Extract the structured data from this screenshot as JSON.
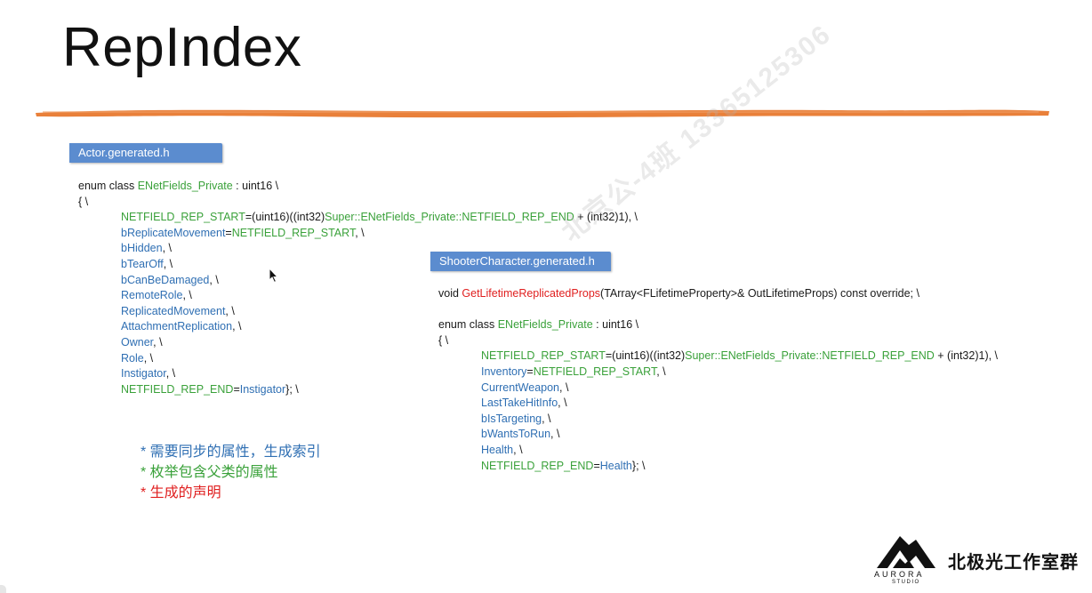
{
  "title": "RepIndex",
  "left_file": {
    "tag": "Actor.generated.h",
    "lines": [
      {
        "indent": 0,
        "parts": [
          {
            "t": "enum class ",
            "c": "k"
          },
          {
            "t": "ENetFields_Private",
            "c": "g"
          },
          {
            "t": " : uint16 \\",
            "c": "k"
          }
        ]
      },
      {
        "indent": 0,
        "parts": [
          {
            "t": "{ \\",
            "c": "k"
          }
        ]
      },
      {
        "indent": 1,
        "parts": [
          {
            "t": "NETFIELD_REP_START",
            "c": "g"
          },
          {
            "t": "=(uint16)((int32)",
            "c": "k"
          },
          {
            "t": "Super::ENetFields_Private::NETFIELD_REP_END",
            "c": "g"
          },
          {
            "t": " + (int32)1), \\",
            "c": "k"
          }
        ]
      },
      {
        "indent": 1,
        "parts": [
          {
            "t": "bReplicateMovement",
            "c": "b"
          },
          {
            "t": "=",
            "c": "k"
          },
          {
            "t": "NETFIELD_REP_START",
            "c": "g"
          },
          {
            "t": ", \\",
            "c": "k"
          }
        ]
      },
      {
        "indent": 1,
        "parts": [
          {
            "t": "bHidden",
            "c": "b"
          },
          {
            "t": ", \\",
            "c": "k"
          }
        ]
      },
      {
        "indent": 1,
        "parts": [
          {
            "t": "bTearOff",
            "c": "b"
          },
          {
            "t": ", \\",
            "c": "k"
          }
        ]
      },
      {
        "indent": 1,
        "parts": [
          {
            "t": "bCanBeDamaged",
            "c": "b"
          },
          {
            "t": ", \\",
            "c": "k"
          }
        ]
      },
      {
        "indent": 1,
        "parts": [
          {
            "t": "RemoteRole",
            "c": "b"
          },
          {
            "t": ", \\",
            "c": "k"
          }
        ]
      },
      {
        "indent": 1,
        "parts": [
          {
            "t": "ReplicatedMovement",
            "c": "b"
          },
          {
            "t": ", \\",
            "c": "k"
          }
        ]
      },
      {
        "indent": 1,
        "parts": [
          {
            "t": "AttachmentReplication",
            "c": "b"
          },
          {
            "t": ", \\",
            "c": "k"
          }
        ]
      },
      {
        "indent": 1,
        "parts": [
          {
            "t": "Owner",
            "c": "b"
          },
          {
            "t": ", \\",
            "c": "k"
          }
        ]
      },
      {
        "indent": 1,
        "parts": [
          {
            "t": "Role",
            "c": "b"
          },
          {
            "t": ", \\",
            "c": "k"
          }
        ]
      },
      {
        "indent": 1,
        "parts": [
          {
            "t": "Instigator",
            "c": "b"
          },
          {
            "t": ", \\",
            "c": "k"
          }
        ]
      },
      {
        "indent": 1,
        "parts": [
          {
            "t": "NETFIELD_REP_END",
            "c": "g"
          },
          {
            "t": "=",
            "c": "k"
          },
          {
            "t": "Instigator",
            "c": "b"
          },
          {
            "t": "}; \\",
            "c": "k"
          }
        ]
      }
    ]
  },
  "right_file": {
    "tag": "ShooterCharacter.generated.h",
    "lines": [
      {
        "indent": 0,
        "parts": [
          {
            "t": "void ",
            "c": "k"
          },
          {
            "t": "GetLifetimeReplicatedProps",
            "c": "r"
          },
          {
            "t": "(TArray<FLifetimeProperty>& OutLifetimeProps) const override; \\",
            "c": "k"
          }
        ]
      },
      {
        "indent": 0,
        "parts": []
      },
      {
        "indent": 0,
        "parts": [
          {
            "t": "enum class ",
            "c": "k"
          },
          {
            "t": "ENetFields_Private",
            "c": "g"
          },
          {
            "t": " : uint16 \\",
            "c": "k"
          }
        ]
      },
      {
        "indent": 0,
        "parts": [
          {
            "t": "{ \\",
            "c": "k"
          }
        ]
      },
      {
        "indent": 1,
        "parts": [
          {
            "t": "NETFIELD_REP_START",
            "c": "g"
          },
          {
            "t": "=(uint16)((int32)",
            "c": "k"
          },
          {
            "t": "Super::ENetFields_Private::NETFIELD_REP_END",
            "c": "g"
          },
          {
            "t": " + (int32)1), \\",
            "c": "k"
          }
        ]
      },
      {
        "indent": 1,
        "parts": [
          {
            "t": "Inventory",
            "c": "b"
          },
          {
            "t": "=",
            "c": "k"
          },
          {
            "t": "NETFIELD_REP_START",
            "c": "g"
          },
          {
            "t": ", \\",
            "c": "k"
          }
        ]
      },
      {
        "indent": 1,
        "parts": [
          {
            "t": "CurrentWeapon",
            "c": "b"
          },
          {
            "t": ", \\",
            "c": "k"
          }
        ]
      },
      {
        "indent": 1,
        "parts": [
          {
            "t": "LastTakeHitInfo",
            "c": "b"
          },
          {
            "t": ", \\",
            "c": "k"
          }
        ]
      },
      {
        "indent": 1,
        "parts": [
          {
            "t": "bIsTargeting",
            "c": "b"
          },
          {
            "t": ", \\",
            "c": "k"
          }
        ]
      },
      {
        "indent": 1,
        "parts": [
          {
            "t": "bWantsToRun",
            "c": "b"
          },
          {
            "t": ", \\",
            "c": "k"
          }
        ]
      },
      {
        "indent": 1,
        "parts": [
          {
            "t": "Health",
            "c": "b"
          },
          {
            "t": ", \\",
            "c": "k"
          }
        ]
      },
      {
        "indent": 1,
        "parts": [
          {
            "t": "NETFIELD_REP_END",
            "c": "g"
          },
          {
            "t": "=",
            "c": "k"
          },
          {
            "t": "Health",
            "c": "b"
          },
          {
            "t": "}; \\",
            "c": "k"
          }
        ]
      }
    ]
  },
  "notes": [
    "* 需要同步的属性，生成索引",
    "* 枚举包含父类的属性",
    "* 生成的声明"
  ],
  "watermark": "北京公-4班 13365125306",
  "logo": {
    "name": "AURORA",
    "sub": "STUDIO",
    "studio_name": "北极光工作室群"
  },
  "colors": {
    "tag_bg": "#5b8ccf",
    "brush": "#e9803a",
    "green": "#3aa13a",
    "blue": "#2f6fb3",
    "red": "#e02020"
  }
}
